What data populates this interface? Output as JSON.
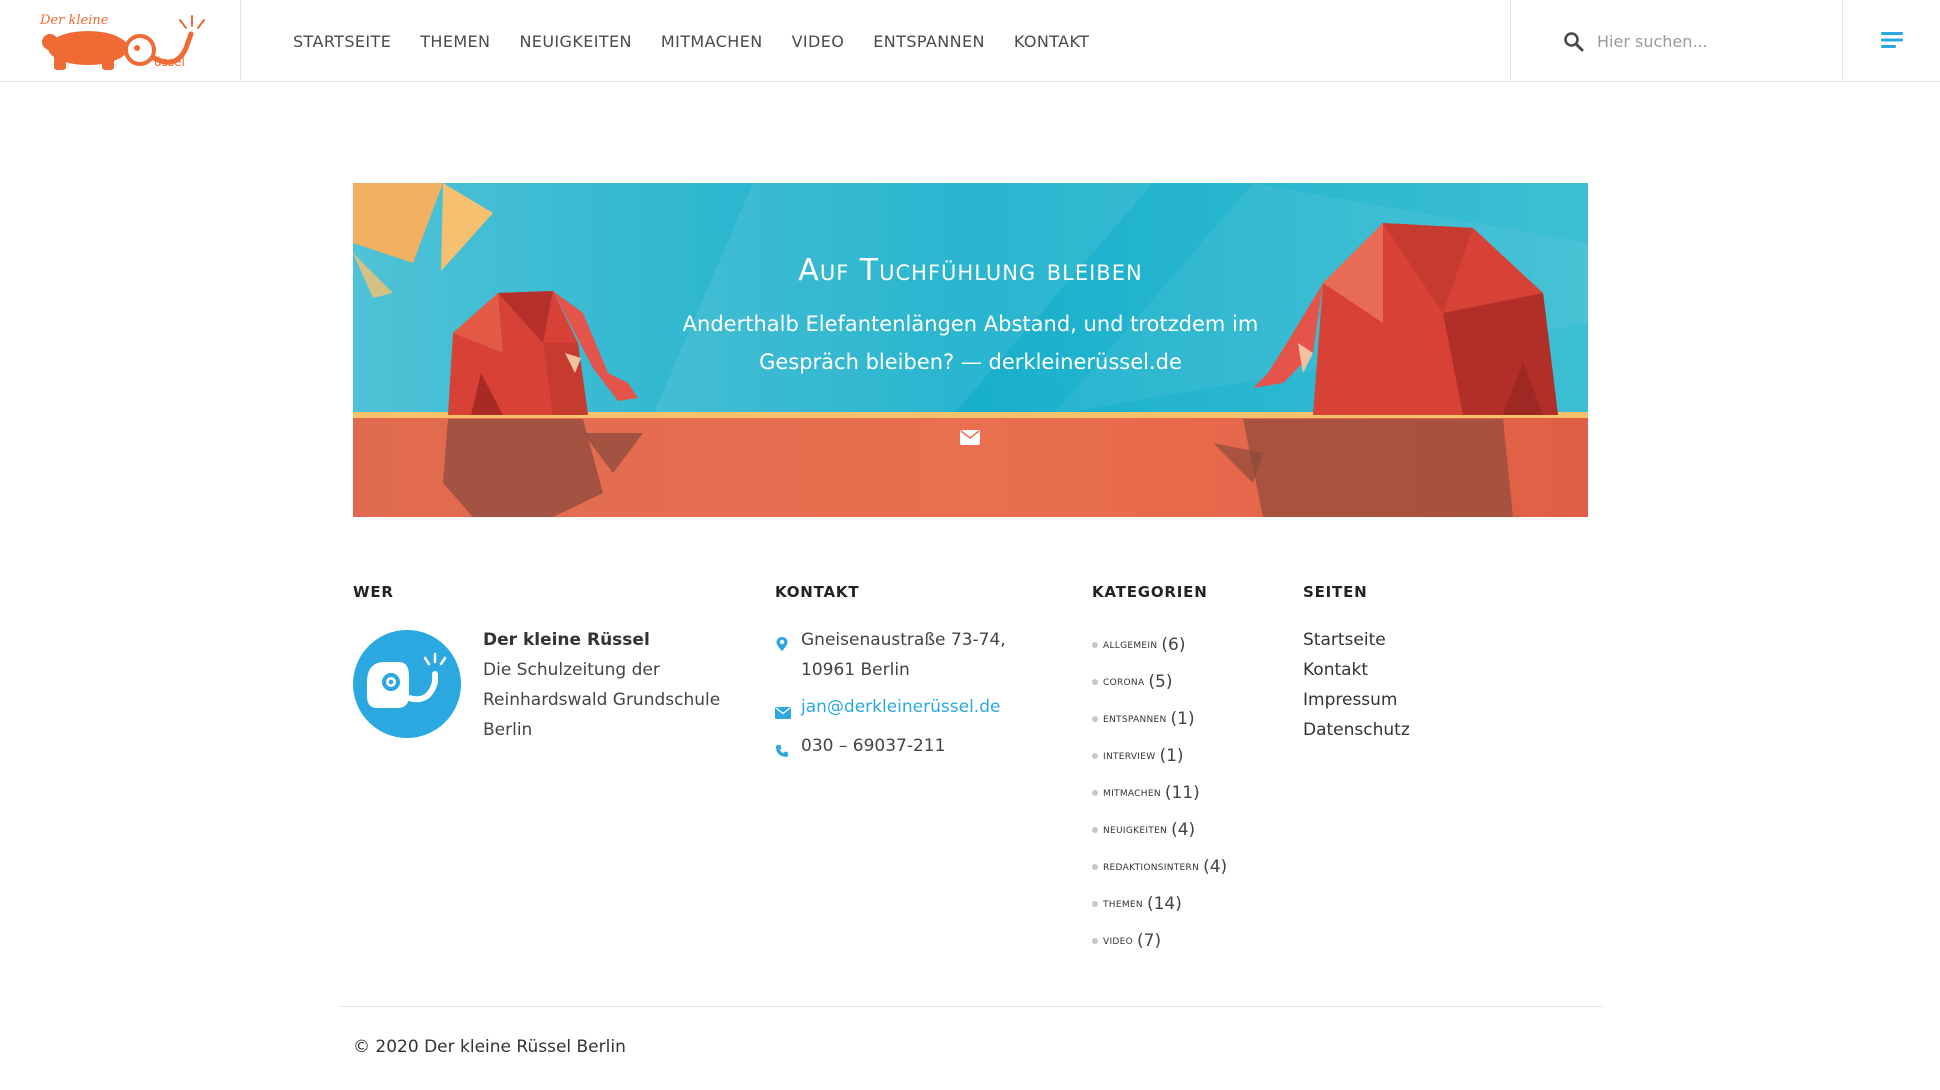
{
  "header": {
    "logo_text": "Der kleine Rüssel",
    "nav": [
      "STARTSEITE",
      "THEMEN",
      "NEUIGKEITEN",
      "MITMACHEN",
      "VIDEO",
      "ENTSPANNEN",
      "KONTAKT"
    ],
    "search_placeholder": "Hier suchen...",
    "search_icon": "search-icon",
    "menu_icon": "hamburger-menu-icon"
  },
  "banner": {
    "title": "Auf Tuchfühlung bleiben",
    "subtitle": "Anderthalb Elefantenlängen Abstand, und trotzdem im Gespräch bleiben? — derkleinerüssel.de",
    "icon": "envelope-icon",
    "colors": {
      "sky": "#1fb3cf",
      "ground": "#e8674d",
      "line": "#f5c16a",
      "elephant": "#e0463a"
    }
  },
  "footer": {
    "wer": {
      "title": "WER",
      "name": "Der kleine Rüssel",
      "description": "Die Schulzeitung der Reinhardswald Grundschule Berlin"
    },
    "kontakt": {
      "title": "KONTAKT",
      "address": "Gneisenaustraße 73-74, 10961 Berlin",
      "email": "jan@derkleinerüssel.de",
      "phone": "030 – 69037-211"
    },
    "kategorien": {
      "title": "KATEGORIEN",
      "items": [
        {
          "name": "ALLGEMEIN",
          "count": "(6)"
        },
        {
          "name": "CORONA",
          "count": "(5)"
        },
        {
          "name": "ENTSPANNEN",
          "count": "(1)"
        },
        {
          "name": "INTERVIEW",
          "count": "(1)"
        },
        {
          "name": "MITMACHEN",
          "count": "(11)"
        },
        {
          "name": "NEUIGKEITEN",
          "count": "(4)"
        },
        {
          "name": "REDAKTIONSINTERN",
          "count": "(4)"
        },
        {
          "name": "THEMEN",
          "count": "(14)"
        },
        {
          "name": "VIDEO",
          "count": "(7)"
        }
      ]
    },
    "seiten": {
      "title": "SEITEN",
      "items": [
        "Startseite",
        "Kontakt",
        "Impressum",
        "Datenschutz"
      ]
    },
    "copyright": "© 2020 Der kleine Rüssel Berlin"
  },
  "colors": {
    "accent": "#2ba8e0",
    "logo": "#f06a35",
    "text": "#333333"
  }
}
